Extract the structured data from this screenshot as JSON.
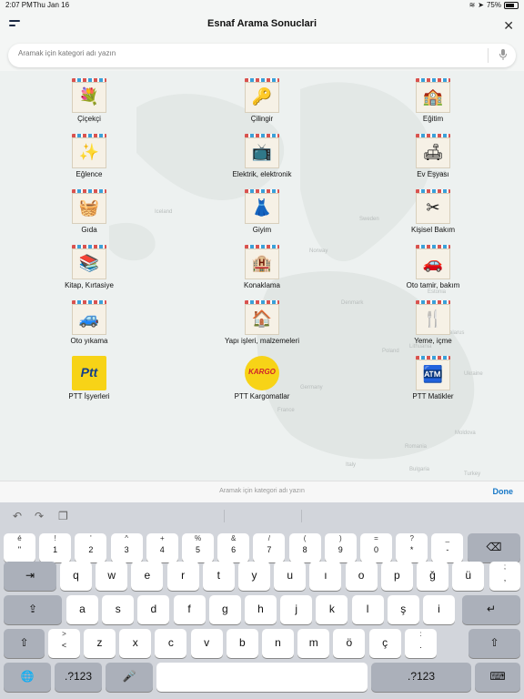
{
  "statusbar": {
    "time": "2:07 PM",
    "date": "Thu Jan 16",
    "battery": "75%"
  },
  "header": {
    "title": "Esnaf Arama Sonuclari"
  },
  "search": {
    "placeholder": "Aramak için kategori adı yazın"
  },
  "map_labels": [
    "Iceland",
    "Sweden",
    "Norway",
    "Finland",
    "Estonia",
    "Latvia",
    "Denmark",
    "Lithuania",
    "Belarus",
    "Poland",
    "Germany",
    "Ukraine",
    "Moldova",
    "France",
    "Romania",
    "Bulgaria",
    "Turkey",
    "Italy"
  ],
  "categories": [
    {
      "label": "Çiçekçi",
      "icon": "flower-icon",
      "glyph": "💐"
    },
    {
      "label": "Çilingir",
      "icon": "key-icon",
      "glyph": "🔑"
    },
    {
      "label": "Eğitim",
      "icon": "classroom-icon",
      "glyph": "🏫"
    },
    {
      "label": "Eğlence",
      "icon": "sparkles-icon",
      "glyph": "✨"
    },
    {
      "label": "Elektrik, elektronik",
      "icon": "appliances-icon",
      "glyph": "📺"
    },
    {
      "label": "Ev Eşyası",
      "icon": "furniture-icon",
      "glyph": "🛋"
    },
    {
      "label": "Gıda",
      "icon": "grocery-basket-icon",
      "glyph": "🧺"
    },
    {
      "label": "Giyim",
      "icon": "clothing-icon",
      "glyph": "👗"
    },
    {
      "label": "Kişisel Bakım",
      "icon": "scissors-icon",
      "glyph": "✂"
    },
    {
      "label": "Kitap, Kırtasiye",
      "icon": "stationery-icon",
      "glyph": "📚"
    },
    {
      "label": "Konaklama",
      "icon": "hotel-icon",
      "glyph": "🏨"
    },
    {
      "label": "Oto tamir, bakım",
      "icon": "car-repair-icon",
      "glyph": "🚗"
    },
    {
      "label": "Oto yıkama",
      "icon": "car-wash-icon",
      "glyph": "🚙"
    },
    {
      "label": "Yapı işleri, malzemeleri",
      "icon": "house-tools-icon",
      "glyph": "🏠"
    },
    {
      "label": "Yeme, içme",
      "icon": "food-icon",
      "glyph": "🍴"
    },
    {
      "label": "PTT İşyerleri",
      "icon": "ptt-logo-icon",
      "glyph": "Ptt"
    },
    {
      "label": "PTT Kargomatlar",
      "icon": "ptt-kargo-logo-icon",
      "glyph": "KARGO"
    },
    {
      "label": "PTT Matikler",
      "icon": "atm-icon",
      "glyph": "🏧"
    }
  ],
  "bottom_bar": {
    "hint": "Aramak için kategori adı yazın",
    "done": "Done"
  },
  "keyboard": {
    "row1": [
      {
        "top": "é",
        "bot": "\""
      },
      {
        "top": "!",
        "bot": "1"
      },
      {
        "top": "'",
        "bot": "2"
      },
      {
        "top": "^",
        "bot": "3"
      },
      {
        "top": "+",
        "bot": "4"
      },
      {
        "top": "%",
        "bot": "5"
      },
      {
        "top": "&",
        "bot": "6"
      },
      {
        "top": "/",
        "bot": "7"
      },
      {
        "top": "(",
        "bot": "8"
      },
      {
        "top": ")",
        "bot": "9"
      },
      {
        "top": "=",
        "bot": "0"
      },
      {
        "top": "?",
        "bot": "*"
      },
      {
        "top": "_",
        "bot": "-"
      }
    ],
    "row2": [
      "q",
      "w",
      "e",
      "r",
      "t",
      "y",
      "u",
      "ı",
      "o",
      "p",
      "ğ",
      "ü"
    ],
    "row2_last": {
      "top": ";",
      "bot": ","
    },
    "row3": [
      "a",
      "s",
      "d",
      "f",
      "g",
      "h",
      "j",
      "k",
      "l",
      "ş",
      "i"
    ],
    "row4_first": {
      "top": ">",
      "bot": "<"
    },
    "row4": [
      "z",
      "x",
      "c",
      "v",
      "b",
      "n",
      "m",
      "ö",
      "ç"
    ],
    "row4_last": {
      "top": ":",
      "bot": "."
    },
    "numbers_label": ".?123"
  },
  "colors": {
    "accent": "#1677c7",
    "ptt_yellow": "#f7d317",
    "ptt_blue": "#153f8a"
  }
}
